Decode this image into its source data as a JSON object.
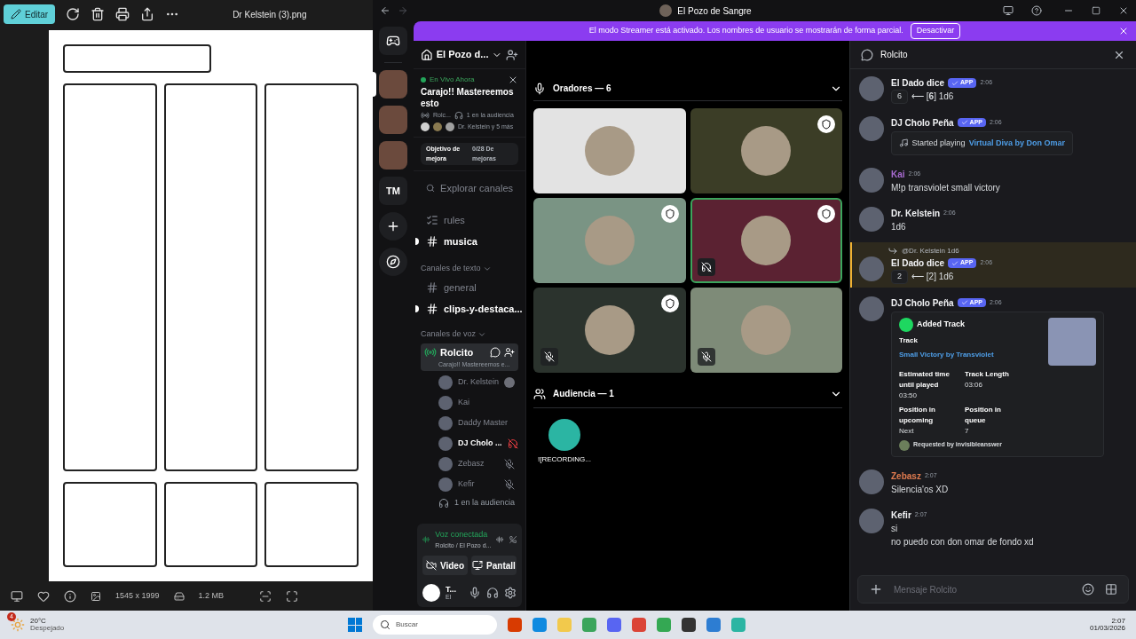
{
  "photo_viewer": {
    "edit_button": "Editar",
    "file_name": "Dr Kelstein (3).png",
    "dimensions": "1545 x 1999",
    "file_size": "1.2 MB"
  },
  "discord": {
    "window_title": "El Pozo de Sangre",
    "banner": {
      "text": "El modo Streamer está activado. Los nombres de usuario se mostrarán de forma parcial.",
      "button": "Desactivar"
    },
    "servers": [
      {
        "kind": "image",
        "selected": true
      },
      {
        "kind": "image",
        "selected": false
      },
      {
        "kind": "image",
        "selected": false
      },
      {
        "kind": "text",
        "label": "TM",
        "selected": false
      }
    ],
    "server_name": "El Pozo d...",
    "live": {
      "badge": "En Vivo Ahora",
      "title": "Carajo!! Mastereemos esto",
      "host": "Rolc...",
      "audience": "1 en la audiencia",
      "participants": "Dr. Kelstein y 5 más"
    },
    "boost": {
      "label": "Objetivo de mejora",
      "value": "0/28 De mejoras"
    },
    "explore": "Explorar canales",
    "channels": [
      {
        "kind": "rules",
        "name": "rules",
        "unread": false
      },
      {
        "kind": "text",
        "name": "musica",
        "unread": true
      }
    ],
    "text_category": "Canales de texto",
    "text_channels": [
      {
        "name": "general",
        "unread": false
      },
      {
        "name": "clips-y-destaca...",
        "unread": true
      }
    ],
    "voice_category": "Canales de voz",
    "voice_channel": {
      "name": "Rolcito",
      "subtitle": "Carajo!! Mastereemos e...",
      "selected": true
    },
    "voice_members": [
      {
        "name": "Dr. Kelstein",
        "kind": "idle",
        "bold": false
      },
      {
        "name": "Kai",
        "kind": "none",
        "bold": false
      },
      {
        "name": "Daddy Master",
        "kind": "none",
        "bold": false
      },
      {
        "name": "DJ Cholo ...",
        "kind": "deafened",
        "bold": true
      },
      {
        "name": "Zebasz",
        "kind": "muted",
        "bold": false
      },
      {
        "name": "Kefir",
        "kind": "muted",
        "bold": false
      }
    ],
    "audience_count": "1 en la audiencia",
    "voice_panel": {
      "status": "Voz conectada",
      "location": "Rolcito / El Pozo d...",
      "video_button": "Video",
      "screen_button": "Pantall"
    },
    "user": {
      "name": "T...",
      "status": "El"
    },
    "speakers_title": "Oradores — 6",
    "speakers": [
      {
        "color": "#e3e3e3",
        "moderator": false,
        "muted": false,
        "deafened": false,
        "speaking": false
      },
      {
        "color": "#3b3d26",
        "moderator": true,
        "muted": false,
        "deafened": false,
        "speaking": false
      },
      {
        "color": "#7a9484",
        "moderator": true,
        "muted": false,
        "deafened": false,
        "speaking": false
      },
      {
        "color": "#5b2232",
        "moderator": true,
        "muted": false,
        "deafened": true,
        "speaking": true
      },
      {
        "color": "#2b332d",
        "moderator": true,
        "muted": true,
        "deafened": false,
        "speaking": false
      },
      {
        "color": "#7e8b78",
        "moderator": false,
        "muted": true,
        "deafened": false,
        "speaking": false
      }
    ],
    "audience_title": "Audiencia — 1",
    "audience": [
      {
        "name": "![RECORDING..."
      }
    ],
    "chat": {
      "title": "Rolcito",
      "placeholder": "Mensaje Rolcito",
      "messages": [
        {
          "kind": "dice",
          "author": "El Dado dice",
          "color": "#f2f3f5",
          "app": "APP",
          "time": "2:06",
          "result": "6",
          "text": "⟵ [**6**] 1d6",
          "highlighted": false
        },
        {
          "kind": "playing",
          "author": "DJ Cholo Peña",
          "color": "#f2f3f5",
          "app": "APP",
          "time": "2:06",
          "prefix": "Started playing",
          "link": "Virtual Diva by Don Omar",
          "highlighted": false
        },
        {
          "kind": "text",
          "author": "Kai",
          "color": "#a86bd1",
          "time": "2:06",
          "lines": [
            "M!p transviolet small victory"
          ],
          "highlighted": false
        },
        {
          "kind": "text",
          "author": "Dr. Kelstein",
          "color": "#f2f3f5",
          "time": "2:06",
          "lines": [
            "1d6"
          ],
          "highlighted": false
        },
        {
          "kind": "dice",
          "author": "El Dado dice",
          "color": "#f2f3f5",
          "app": "APP",
          "time": "2:06",
          "reply": "@Dr. Kelstein 1d6",
          "result": "2",
          "text": "⟵ [2] 1d6",
          "highlighted": true
        },
        {
          "kind": "embed",
          "author": "DJ Cholo Peña",
          "color": "#f2f3f5",
          "app": "APP",
          "time": "2:06",
          "highlighted": false,
          "embed": {
            "title": "Added Track",
            "track_label": "Track",
            "track": "Small Victory by Transviolet",
            "fields": [
              {
                "name": "Estimated time until played",
                "value": "03:50"
              },
              {
                "name": "Track Length",
                "value": "03:06"
              },
              {
                "name": "Position in upcoming",
                "value": "Next"
              },
              {
                "name": "Position in queue",
                "value": "7"
              }
            ],
            "footer": "Requested by invisibleanswer"
          }
        },
        {
          "kind": "text",
          "author": "Zebasz",
          "color": "#e07b4f",
          "time": "2:07",
          "lines": [
            "Silencia'os XD"
          ],
          "highlighted": false
        },
        {
          "kind": "text",
          "author": "Kefir",
          "color": "#f2f3f5",
          "time": "2:07",
          "lines": [
            "si",
            "no puedo con don omar de fondo xd"
          ],
          "highlighted": false
        }
      ]
    }
  },
  "taskbar": {
    "weather": {
      "badge": "4",
      "temperature": "20°C",
      "condition": "Despejado"
    },
    "search": "Buscar",
    "time": "2:07",
    "date": "01/03/2026"
  }
}
